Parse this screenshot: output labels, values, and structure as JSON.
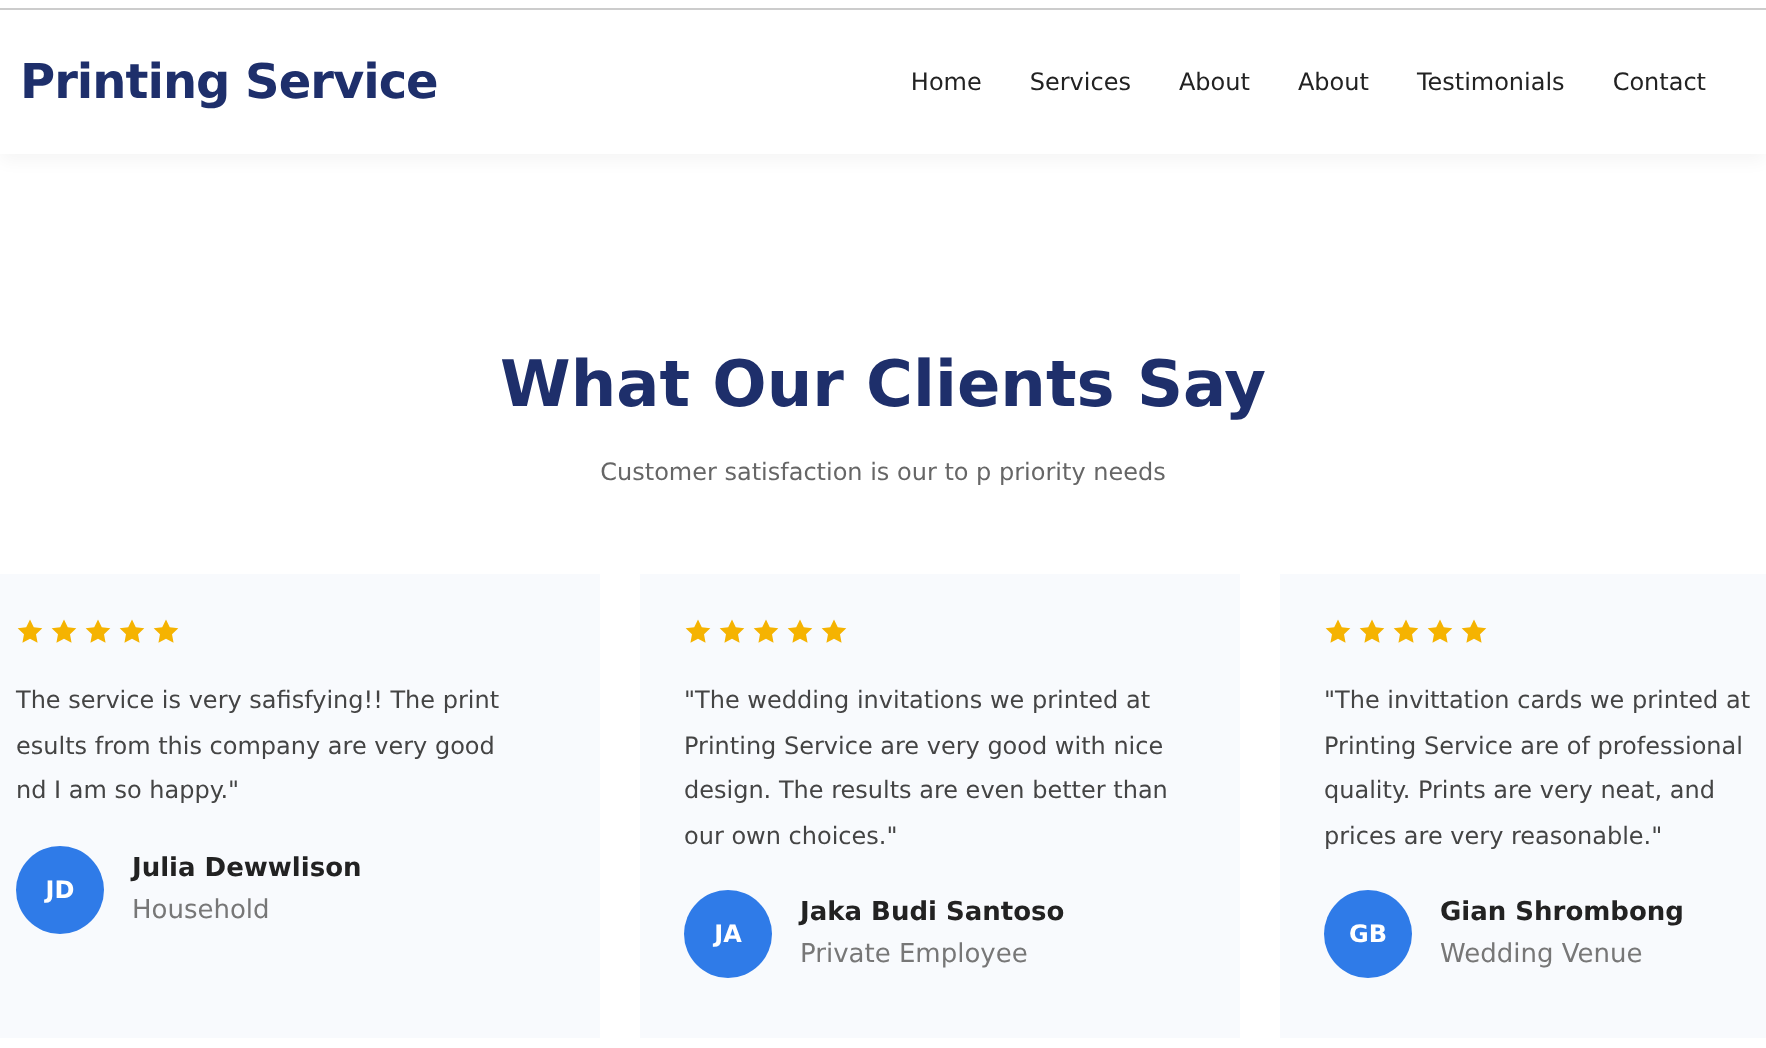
{
  "header": {
    "logo": "Printing Service",
    "nav": [
      "Home",
      "Services",
      "About",
      "About",
      "Testimonials",
      "Contact"
    ]
  },
  "section": {
    "title": "What Our Clients Say",
    "subtitle": "Customer satisfaction is our to p priority needs"
  },
  "testimonials": [
    {
      "stars": 5,
      "quote_lines": [
        "The service is very safisfying!! The print",
        "esults from this company are very good",
        "nd I am so happy.\""
      ],
      "initials": "JD",
      "name": "Julia Dewwlison",
      "role": "Household"
    },
    {
      "stars": 5,
      "quote_lines": [
        "\"The wedding invitations we printed at",
        "Printing Service are very good with nice",
        "design. The results are even better than",
        "our own choices.\""
      ],
      "initials": "JA",
      "name": "Jaka Budi Santoso",
      "role": "Private Employee"
    },
    {
      "stars": 5,
      "quote_lines": [
        "\"The invittation cards we printed at",
        "Printing Service are of professional",
        "quality. Prints are very neat, and",
        "prices are very reasonable.\""
      ],
      "initials": "GB",
      "name": "Gian Shrombong",
      "role": "Wedding Venue"
    }
  ]
}
